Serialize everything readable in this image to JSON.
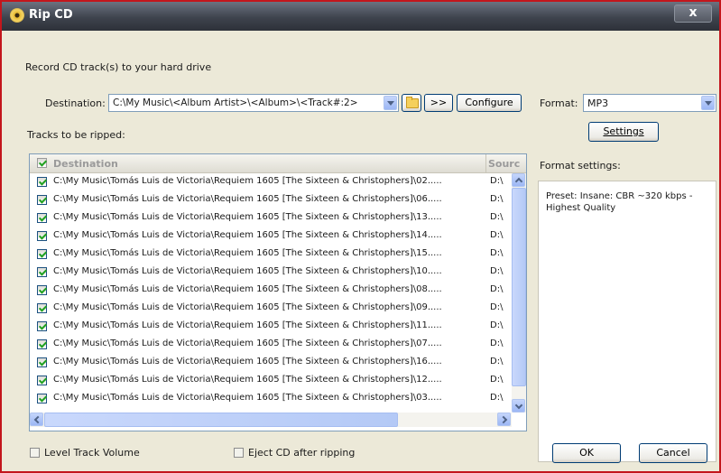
{
  "window": {
    "title": "Rip CD",
    "close_label": "x"
  },
  "instruction": "Record CD track(s) to your hard drive",
  "destination": {
    "label": "Destination:",
    "value": "C:\\My Music\\<Album Artist>\\<Album>\\<Track#:2>",
    "browse_more_label": ">>",
    "configure_label": "Configure"
  },
  "format": {
    "label": "Format:",
    "value": "MP3",
    "settings_label": "Settings",
    "settings_heading": "Format settings:",
    "preset_text": "Preset: Insane: CBR ~320 kbps - Highest Quality"
  },
  "tracks": {
    "heading": "Tracks to be ripped:",
    "columns": {
      "destination": "Destination",
      "source": "Sourc"
    },
    "rows": [
      {
        "destination": "C:\\My Music\\Tomás Luis de Victoria\\Requiem 1605 [The Sixteen & Christophers]\\02.....",
        "source": "D:\\",
        "checked": true
      },
      {
        "destination": "C:\\My Music\\Tomás Luis de Victoria\\Requiem 1605 [The Sixteen & Christophers]\\06.....",
        "source": "D:\\",
        "checked": true
      },
      {
        "destination": "C:\\My Music\\Tomás Luis de Victoria\\Requiem 1605 [The Sixteen & Christophers]\\13.....",
        "source": "D:\\",
        "checked": true
      },
      {
        "destination": "C:\\My Music\\Tomás Luis de Victoria\\Requiem 1605 [The Sixteen & Christophers]\\14.....",
        "source": "D:\\",
        "checked": true
      },
      {
        "destination": "C:\\My Music\\Tomás Luis de Victoria\\Requiem 1605 [The Sixteen & Christophers]\\15.....",
        "source": "D:\\",
        "checked": true
      },
      {
        "destination": "C:\\My Music\\Tomás Luis de Victoria\\Requiem 1605 [The Sixteen & Christophers]\\10.....",
        "source": "D:\\",
        "checked": true
      },
      {
        "destination": "C:\\My Music\\Tomás Luis de Victoria\\Requiem 1605 [The Sixteen & Christophers]\\08.....",
        "source": "D:\\",
        "checked": true
      },
      {
        "destination": "C:\\My Music\\Tomás Luis de Victoria\\Requiem 1605 [The Sixteen & Christophers]\\09.....",
        "source": "D:\\",
        "checked": true
      },
      {
        "destination": "C:\\My Music\\Tomás Luis de Victoria\\Requiem 1605 [The Sixteen & Christophers]\\11.....",
        "source": "D:\\",
        "checked": true
      },
      {
        "destination": "C:\\My Music\\Tomás Luis de Victoria\\Requiem 1605 [The Sixteen & Christophers]\\07.....",
        "source": "D:\\",
        "checked": true
      },
      {
        "destination": "C:\\My Music\\Tomás Luis de Victoria\\Requiem 1605 [The Sixteen & Christophers]\\16.....",
        "source": "D:\\",
        "checked": true
      },
      {
        "destination": "C:\\My Music\\Tomás Luis de Victoria\\Requiem 1605 [The Sixteen & Christophers]\\12.....",
        "source": "D:\\",
        "checked": true
      },
      {
        "destination": "C:\\My Music\\Tomás Luis de Victoria\\Requiem 1605 [The Sixteen & Christophers]\\03.....",
        "source": "D:\\",
        "checked": true
      }
    ]
  },
  "options": {
    "level_volume_label": "Level Track Volume",
    "eject_label": "Eject CD after ripping"
  },
  "buttons": {
    "ok": "OK",
    "cancel": "Cancel"
  },
  "icons": {
    "title": "cd-icon",
    "folder": "folder-icon"
  },
  "colors": {
    "frame_border": "#c3161c",
    "titlebar": "#3e434d",
    "dialog_bg": "#ece9d8"
  }
}
